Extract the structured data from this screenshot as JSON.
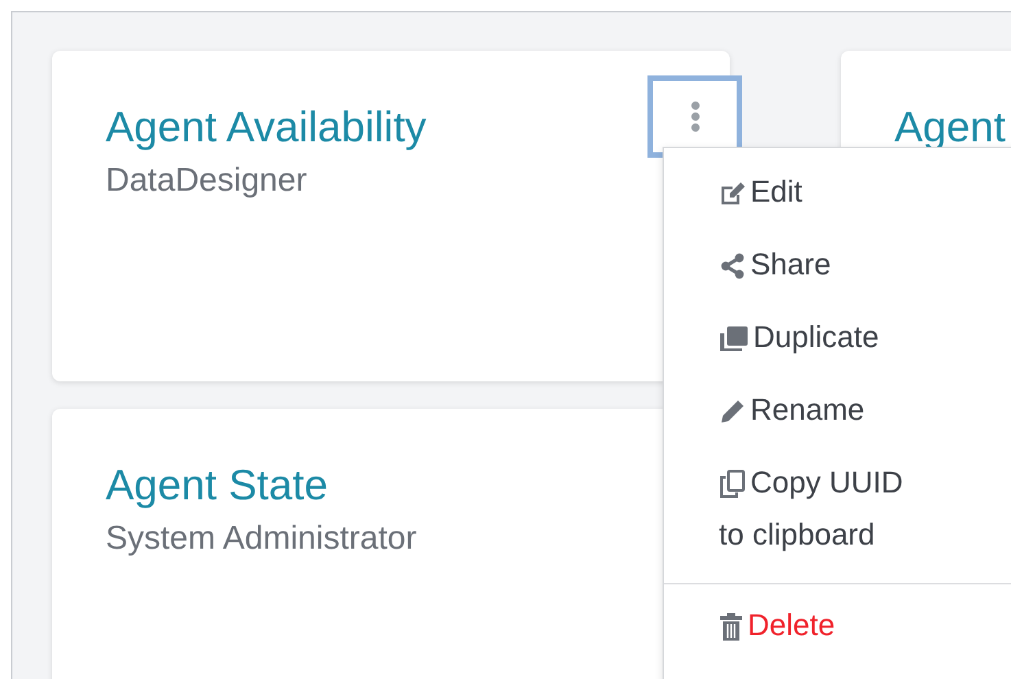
{
  "cards": [
    {
      "title": "Agent Availability",
      "owner": "DataDesigner",
      "menu_open": true
    },
    {
      "title": "Agent",
      "menu_open": false
    },
    {
      "title": "Agent State",
      "owner": "System Administrator",
      "menu_open": false
    }
  ],
  "menu": {
    "items": [
      {
        "label": "Edit",
        "kind": "normal"
      },
      {
        "label": "Share",
        "kind": "normal"
      },
      {
        "label": "Duplicate",
        "kind": "normal"
      },
      {
        "label": "Rename",
        "kind": "normal"
      },
      {
        "label": "Copy UUID to clipboard",
        "kind": "normal"
      },
      {
        "label": "Delete",
        "kind": "danger"
      }
    ]
  }
}
